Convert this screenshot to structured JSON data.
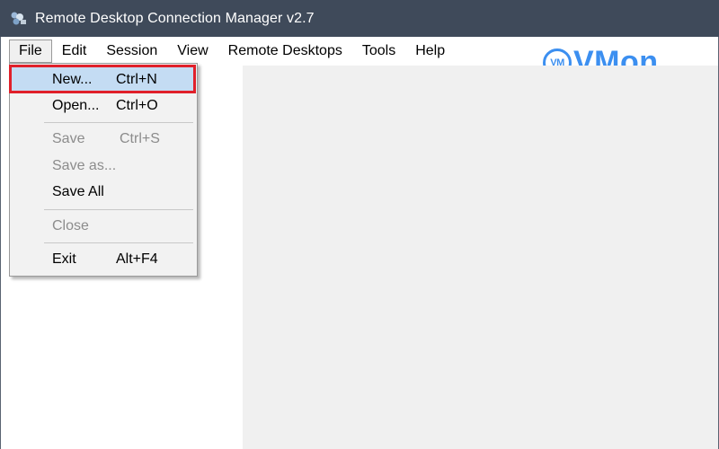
{
  "window": {
    "title": "Remote Desktop Connection Manager v2.7",
    "icon": "rdcman-app-icon"
  },
  "menubar": {
    "items": [
      "File",
      "Edit",
      "Session",
      "View",
      "Remote Desktops",
      "Tools",
      "Help"
    ],
    "open_menu": "File"
  },
  "file_menu": {
    "items": [
      {
        "label": "New...",
        "shortcut": "Ctrl+N",
        "enabled": true,
        "highlighted": true
      },
      {
        "label": "Open...",
        "shortcut": "Ctrl+O",
        "enabled": true
      },
      {
        "label": "Save",
        "shortcut": "Ctrl+S",
        "enabled": false
      },
      {
        "label": "Save as...",
        "shortcut": "",
        "enabled": false
      },
      {
        "label": "Save All",
        "shortcut": "",
        "enabled": true
      },
      {
        "label": "Close",
        "shortcut": "",
        "enabled": false
      },
      {
        "label": "Exit",
        "shortcut": "Alt+F4",
        "enabled": true
      }
    ]
  },
  "watermark": {
    "badge": "VM",
    "text": "VMon",
    "color": "#3c8ff0"
  },
  "colors": {
    "titlebar": "#3f4a5a",
    "highlight": "#c4dcf3",
    "annotation_frame": "#e0202a"
  }
}
